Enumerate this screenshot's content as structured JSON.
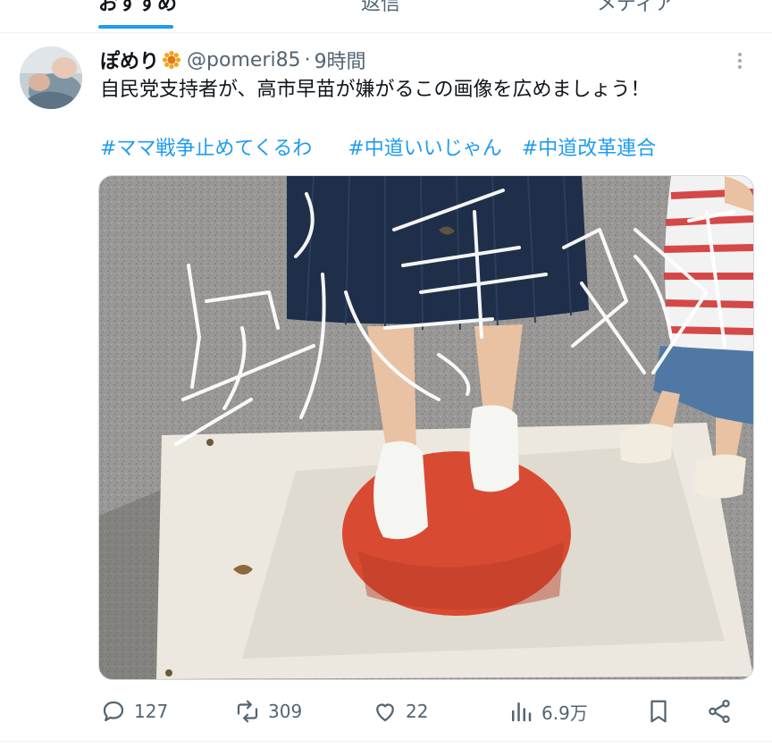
{
  "tabs": [
    "おすすめ",
    "返信",
    "メディア"
  ],
  "post": {
    "author_name": "ぽめり",
    "handle": "@pomeri85",
    "separator": "·",
    "time": "9時間",
    "text": "自民党支持者が、高市早苗が嫌がるこの画像を広めましょう！",
    "hashtags": [
      "#ママ戦争止めてくるわ",
      "#中道いいじゃん",
      "#中道改革連合"
    ],
    "image_handwriting": "戦争反対",
    "stats": {
      "replies": "127",
      "reposts": "309",
      "likes": "22",
      "views": "6.9万"
    }
  },
  "colors": {
    "accent": "#1d9bf0",
    "text": "#0f1419",
    "muted": "#536471",
    "flag_red": "#d94a32"
  },
  "icons": [
    "flower-emoji-icon",
    "more-options-icon",
    "reply-icon",
    "repost-icon",
    "like-icon",
    "views-icon",
    "bookmark-icon",
    "share-icon"
  ]
}
